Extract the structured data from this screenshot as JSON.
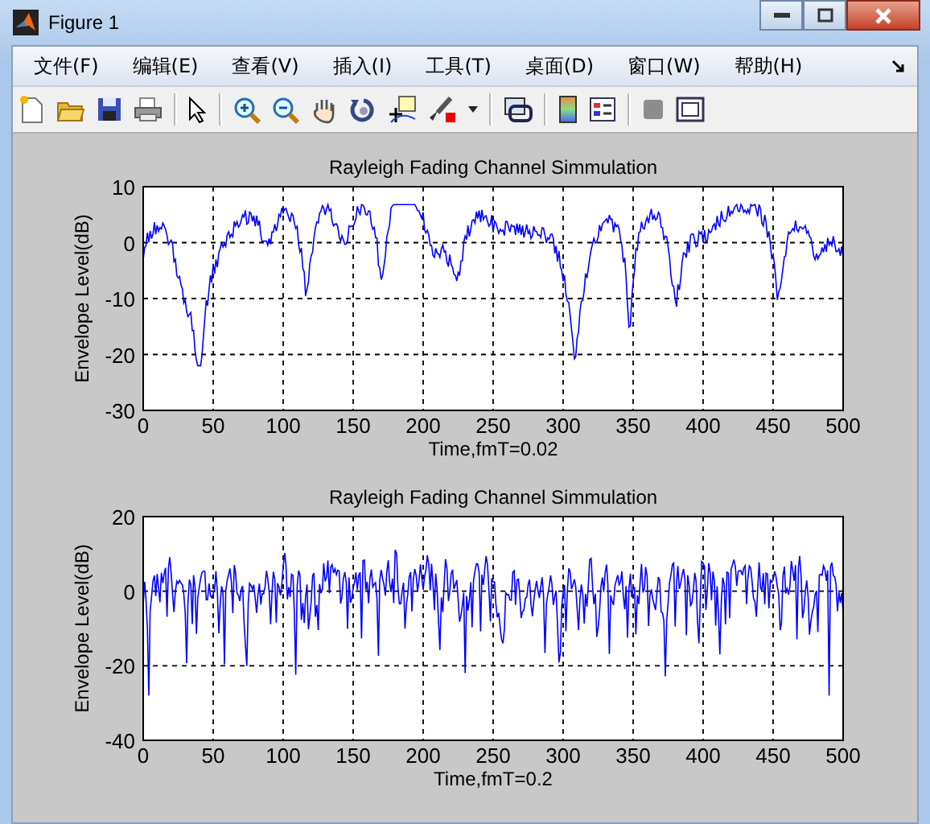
{
  "window": {
    "title": "Figure 1"
  },
  "menu": [
    "文件(F)",
    "编辑(E)",
    "查看(V)",
    "插入(I)",
    "工具(T)",
    "桌面(D)",
    "窗口(W)",
    "帮助(H)"
  ],
  "plots": [
    {
      "kind": "slow",
      "title": "Rayleigh Fading Channel Simmulation",
      "xlabel": "Time,fmT=0.02",
      "ylabel": "Envelope Level(dB)",
      "xticks": [
        "0",
        "50",
        "100",
        "150",
        "200",
        "250",
        "300",
        "350",
        "400",
        "450",
        "500"
      ],
      "yticks": [
        "10",
        "0",
        "-10",
        "-20",
        "-30"
      ],
      "grid": true
    },
    {
      "kind": "fast",
      "title": "Rayleigh Fading Channel Simmulation",
      "xlabel": "Time,fmT=0.2",
      "ylabel": "Envelope Level(dB)",
      "xticks": [
        "0",
        "50",
        "100",
        "150",
        "200",
        "250",
        "300",
        "350",
        "400",
        "450",
        "500"
      ],
      "yticks": [
        "20",
        "0",
        "-20",
        "-40"
      ],
      "grid": true
    }
  ]
}
